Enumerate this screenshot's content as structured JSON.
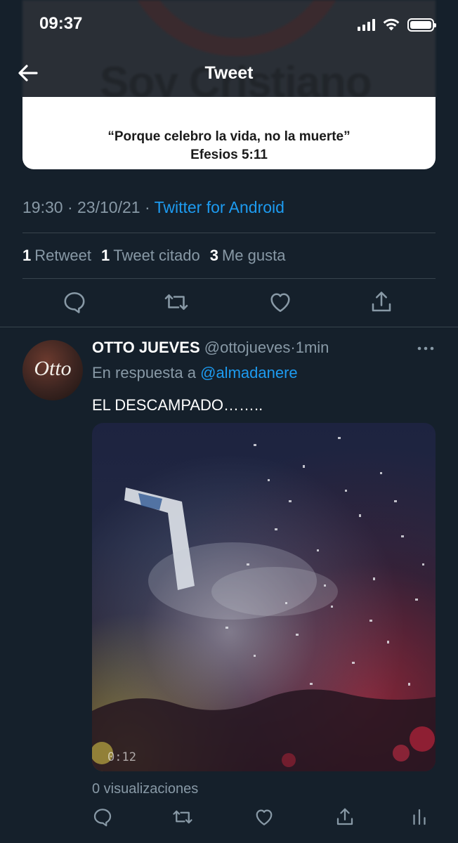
{
  "status_bar": {
    "time": "09:37",
    "signal_icon": "cellular-signal-icon",
    "wifi_icon": "wifi-icon",
    "battery_icon": "battery-icon"
  },
  "nav": {
    "back_icon": "arrow-left-icon",
    "title": "Tweet"
  },
  "main_tweet": {
    "image": {
      "blurred_heading": "Soy Cristiano",
      "quote": "“Porque celebro la vida, no la muerte”",
      "reference": "Efesios 5:11"
    },
    "meta": {
      "time": "19:30",
      "separator": "·",
      "date": "23/10/21",
      "source": "Twitter for Android"
    },
    "stats": [
      {
        "count": "1",
        "label": "Retweet"
      },
      {
        "count": "1",
        "label": "Tweet citado"
      },
      {
        "count": "3",
        "label": "Me gusta"
      }
    ],
    "actions": [
      "reply-icon",
      "retweet-icon",
      "like-icon",
      "share-icon"
    ]
  },
  "reply_tweet": {
    "avatar_text": "Otto",
    "name": "OTTO JUEVES",
    "handle": "@ottojueves",
    "separator": "·",
    "time": "1min",
    "reply_prefix": "En respuesta a",
    "reply_mention": "@almadanere",
    "text": "EL DESCAMPADO……..",
    "video": {
      "timestamp": "0:12"
    },
    "views": "0 visualizaciones",
    "actions": [
      "reply-icon",
      "retweet-icon",
      "like-icon",
      "share-icon",
      "analytics-icon"
    ]
  },
  "colors": {
    "background": "#15202b",
    "divider": "#38444d",
    "secondary_text": "#8899a6",
    "link": "#1d9bf0"
  }
}
